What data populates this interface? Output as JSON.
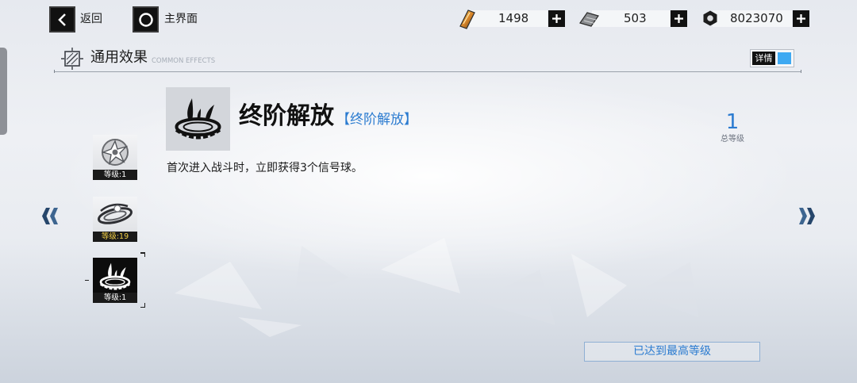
{
  "top_bar": {
    "back": {
      "label": "返回",
      "icon": "chevron-left-icon"
    },
    "home": {
      "label": "主界面",
      "icon": "circle-home-icon"
    },
    "currencies": [
      {
        "icon": "gold-card-icon",
        "value": "1498"
      },
      {
        "icon": "gray-card-icon",
        "value": "503"
      },
      {
        "icon": "hex-nut-icon",
        "value": "8023070"
      }
    ]
  },
  "section": {
    "title": "通用效果",
    "subtitle": "COMMON EFFECTS",
    "icon": "effects-frame-icon",
    "detail_toggle": {
      "label": "详情",
      "on": true
    }
  },
  "effect": {
    "icon": "flame-ring-icon",
    "name": "终阶解放",
    "tag": "【终阶解放】",
    "description": "首次进入战斗时，立即获得3个信号球。",
    "total_level": "1",
    "total_level_label": "总等级"
  },
  "effect_list": [
    {
      "icon": "shuriken-emblem-icon",
      "level_label": "等级:1",
      "selected": false
    },
    {
      "icon": "orbit-rings-icon",
      "level_label": "等级:19",
      "selected": false,
      "highlight": true
    },
    {
      "icon": "flame-ring-icon",
      "level_label": "等级:1",
      "selected": true
    }
  ],
  "navigation": {
    "prev_icon": "double-chevron-left-icon",
    "next_icon": "double-chevron-right-icon"
  },
  "max_level_button": {
    "label": "已达到最高等级"
  },
  "colors": {
    "accent": "#2b7bd0",
    "toggle": "#3ea9f2",
    "highlight": "#f2cf47",
    "dark": "#111111"
  }
}
